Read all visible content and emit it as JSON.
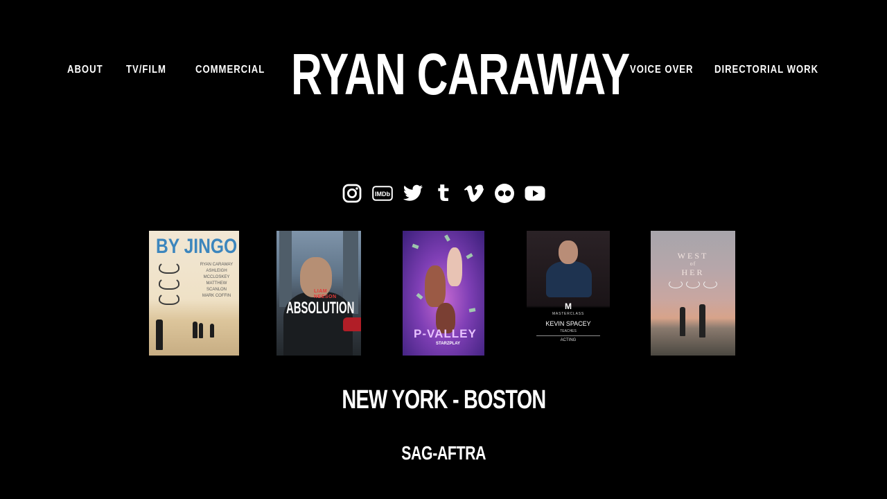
{
  "site": {
    "title": "RYAN CARAWAY"
  },
  "nav": {
    "left": [
      {
        "label": "ABOUT"
      },
      {
        "label": "TV/FILM"
      },
      {
        "label": "COMMERCIAL"
      }
    ],
    "right": [
      {
        "label": "VOICE OVER"
      },
      {
        "label": "DIRECTORIAL WORK"
      }
    ]
  },
  "social": {
    "icons": [
      "instagram-icon",
      "imdb-icon",
      "twitter-icon",
      "tumblr-icon",
      "vimeo-icon",
      "flickr-icon",
      "youtube-icon"
    ],
    "imdb_text": "IMDb",
    "tumblr_text": "t",
    "vimeo_text": "v"
  },
  "posters": [
    {
      "title": "BY JINGO",
      "cast": [
        "RYAN CARAWAY",
        "ASHLEIGH MCCLOSKEY",
        "MATTHEW SCANLON",
        "MARK COFFIN"
      ],
      "bg": "#efe1c6",
      "accent": "#3c86bd"
    },
    {
      "title": "ABSOLUTION",
      "actor_first": "LIAM",
      "actor_last": "NEESON",
      "accent": "#e43a3a"
    },
    {
      "title": "P-VALLEY",
      "network": "STARZPLAY",
      "accent": "#e8c2ff"
    },
    {
      "logo": "M",
      "brand": "MASTERCLASS",
      "name": "KEVIN SPACEY",
      "teaches": "TEACHES",
      "subject": "ACTING"
    },
    {
      "title_lines": [
        "WEST",
        "of",
        "HER"
      ]
    }
  ],
  "footer": {
    "location": "NEW YORK - BOSTON",
    "union": "SAG-AFTRA"
  },
  "colors": {
    "background": "#000000",
    "text": "#ffffff"
  }
}
